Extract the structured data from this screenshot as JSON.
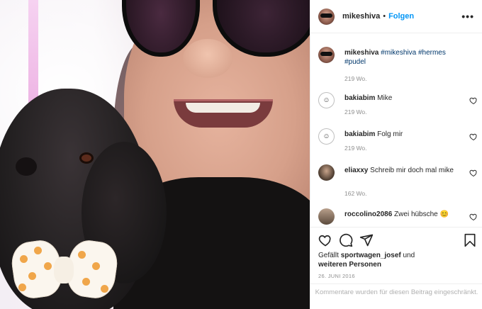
{
  "header": {
    "username": "mikeshiva",
    "separator": "•",
    "follow_label": "Folgen",
    "more_icon": "more-dots-icon"
  },
  "caption": {
    "username": "mikeshiva",
    "text": "#mikeshiva #hermes #pudel",
    "time": "219 Wo."
  },
  "comments": [
    {
      "username": "bakiabim",
      "text": "Mike",
      "time": "219 Wo."
    },
    {
      "username": "bakiabim",
      "text": "Folg mir",
      "time": "219 Wo."
    },
    {
      "username": "eliaxxy",
      "text": "Schreib mir doch mal mike",
      "time": "162 Wo."
    },
    {
      "username": "roccolino2086",
      "text": "Zwei hübsche 😊",
      "time": ""
    }
  ],
  "actions": {
    "like_icon": "heart-icon",
    "comment_icon": "comment-bubble-icon",
    "share_icon": "paper-plane-icon",
    "save_icon": "bookmark-icon"
  },
  "likes": {
    "prefix": "Gefällt",
    "user": "sportwagen_josef",
    "mid": "und",
    "others": "weiteren Personen"
  },
  "date": "26. JUNI 2016",
  "comments_disabled": "Kommentare wurden für diesen Beitrag eingeschränkt."
}
